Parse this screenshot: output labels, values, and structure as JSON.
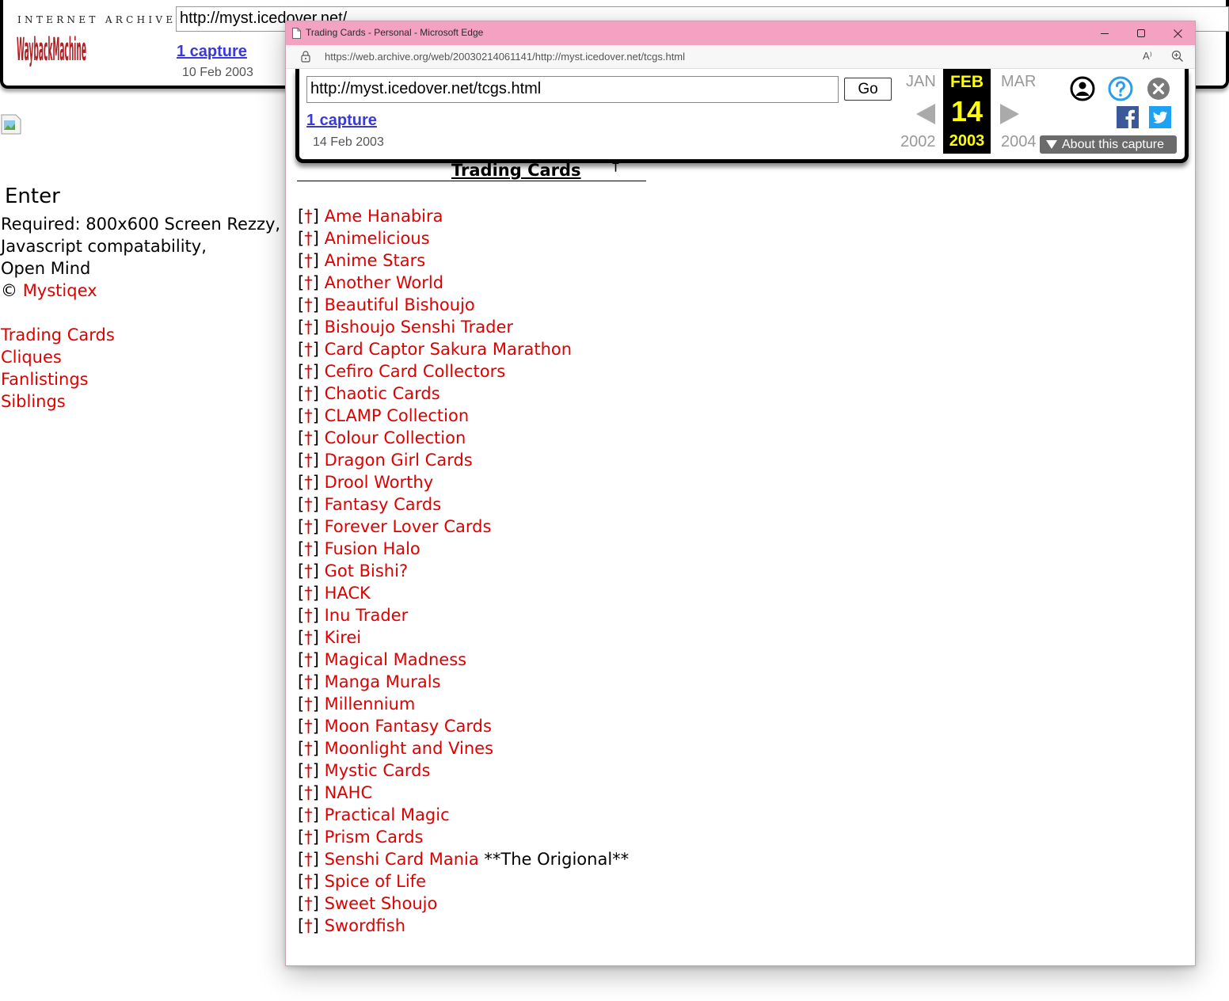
{
  "background_page": {
    "wayback": {
      "logo_top": "INTERNET ARCHIVE",
      "logo_main": "WaybackMachine",
      "url_value": "http://myst.icedover.net/",
      "capture_link": "1 capture",
      "capture_date": "10 Feb 2003"
    },
    "enter": "Enter",
    "requirements": [
      "Required: 800x600 Screen Rezzy,",
      "Javascript compatability,",
      "Open Mind"
    ],
    "copyright_symbol": "©",
    "copyright_name": "Mystiqex",
    "nav": [
      "Trading Cards",
      "Cliques",
      "Fanlistings",
      "Siblings"
    ]
  },
  "window": {
    "title": "Trading Cards - Personal - Microsoft Edge",
    "address": "https://web.archive.org/web/20030214061141/http://myst.icedover.net/tcgs.html",
    "read_aloud_icon": "A⁾"
  },
  "wayback": {
    "url_value": "http://myst.icedover.net/tcgs.html",
    "go_label": "Go",
    "capture_link": "1 capture",
    "capture_date": "14 Feb 2003",
    "prev_month": "JAN",
    "cur_month": "FEB",
    "next_month": "MAR",
    "prev_year": "2002",
    "cur_day": "14",
    "cur_year": "2003",
    "next_year": "2004",
    "about_label": "About this capture"
  },
  "content": {
    "title": "Trading Cards",
    "dagger": "†",
    "bracket_open": "[",
    "bracket_close": "]",
    "tcgs": [
      {
        "name": "Ame Hanabira",
        "note": ""
      },
      {
        "name": "Animelicious",
        "note": ""
      },
      {
        "name": "Anime Stars",
        "note": ""
      },
      {
        "name": "Another World",
        "note": ""
      },
      {
        "name": "Beautiful Bishoujo",
        "note": ""
      },
      {
        "name": "Bishoujo Senshi Trader",
        "note": ""
      },
      {
        "name": "Card Captor Sakura Marathon",
        "note": ""
      },
      {
        "name": "Cefiro Card Collectors",
        "note": ""
      },
      {
        "name": "Chaotic Cards",
        "note": ""
      },
      {
        "name": "CLAMP Collection",
        "note": ""
      },
      {
        "name": "Colour Collection",
        "note": ""
      },
      {
        "name": "Dragon Girl Cards",
        "note": ""
      },
      {
        "name": "Drool Worthy",
        "note": ""
      },
      {
        "name": "Fantasy Cards",
        "note": ""
      },
      {
        "name": "Forever Lover Cards",
        "note": ""
      },
      {
        "name": "Fusion Halo",
        "note": ""
      },
      {
        "name": "Got Bishi?",
        "note": ""
      },
      {
        "name": "HACK",
        "note": ""
      },
      {
        "name": "Inu Trader",
        "note": ""
      },
      {
        "name": "Kirei",
        "note": ""
      },
      {
        "name": "Magical Madness",
        "note": ""
      },
      {
        "name": "Manga Murals",
        "note": ""
      },
      {
        "name": "Millennium",
        "note": ""
      },
      {
        "name": "Moon Fantasy Cards",
        "note": ""
      },
      {
        "name": "Moonlight and Vines",
        "note": ""
      },
      {
        "name": "Mystic Cards",
        "note": ""
      },
      {
        "name": "NAHC",
        "note": ""
      },
      {
        "name": "Practical Magic",
        "note": ""
      },
      {
        "name": "Prism Cards",
        "note": ""
      },
      {
        "name": "Senshi Card Mania",
        "note": "**The Origional**"
      },
      {
        "name": "Spice of Life",
        "note": ""
      },
      {
        "name": "Sweet Shoujo",
        "note": ""
      },
      {
        "name": "Swordfish",
        "note": ""
      }
    ]
  },
  "colors": {
    "link_red": "#e00000",
    "titlebar_pink": "#f3a2c2",
    "wayback_blue": "#3a3ad8",
    "calendar_yellow": "#ffff00"
  }
}
